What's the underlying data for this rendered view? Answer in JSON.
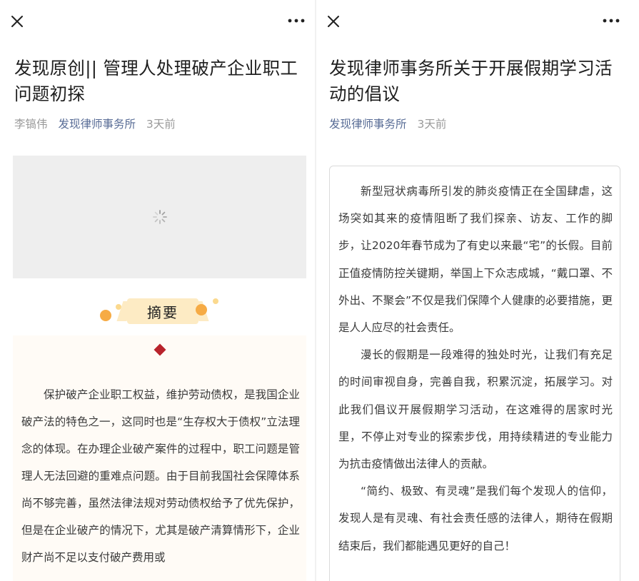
{
  "left": {
    "title": "发现原创|| 管理人处理破产企业职工问题初探",
    "author": "李镐伟",
    "account": "发现律师事务所",
    "time": "3天前",
    "summary_heading": "摘要",
    "summary_text": "保护破产企业职工权益，维护劳动债权，是我国企业破产法的特色之一，这同时也是“生存权大于债权”立法理念的体现。在办理企业破产案件的过程中，职工问题是管理人无法回避的重难点问题。由于目前我国社会保障体系尚不够完善，虽然法律法规对劳动债权给予了优先保护，但是在企业破产的情况下，尤其是破产清算情形下，企业财产尚不足以支付破产费用或"
  },
  "right": {
    "title": "发现律师事务所关于开展假期学习活动的倡议",
    "account": "发现律师事务所",
    "time": "3天前",
    "paragraphs": [
      "新型冠状病毒所引发的肺炎疫情正在全国肆虐，这场突如其来的疫情阻断了我们探亲、访友、工作的脚步，让2020年春节成为了有史以来最“宅”的长假。目前正值疫情防控关键期，举国上下众志成城，“戴口罩、不外出、不聚会”不仅是我们保障个人健康的必要措施，更是人人应尽的社会责任。",
      "漫长的假期是一段难得的独处时光，让我们有充足的时间审视自身，完善自我，积累沉淀，拓展学习。对此我们倡议开展假期学习活动，在这难得的居家时光里，不停止对专业的探索步伐，用持续精进的专业能力为抗击疫情做出法律人的贡献。",
      "“简约、极致、有灵魂”是我们每个发现人的信仰，发现人是有灵魂、有社会责任感的法律人，期待在假期结束后，我们都能遇见更好的自己！"
    ]
  },
  "colors": {
    "account_link": "#576b95",
    "meta_gray": "#9a9a9a",
    "summary_bg": "#fffbf6",
    "ribbon": "#fdebc4",
    "accent_dot": "#f6ab45",
    "diamond": "#b8232c"
  },
  "icons": {
    "close": "close-icon",
    "more": "more-icon",
    "loading": "loading-icon",
    "diamond": "diamond-icon"
  }
}
